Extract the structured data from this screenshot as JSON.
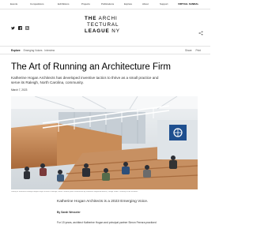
{
  "topnav": {
    "items": [
      "Events",
      "Competitions",
      "Exhibitions",
      "Projects",
      "Publications",
      "Explore",
      "About",
      "Support"
    ],
    "cta": "VIRTUAL SANDAL"
  },
  "logo": {
    "line1_bold": "THE",
    "line1_light": "ARCHI",
    "line2": "TECTURAL",
    "line3_bold": "LEAGUE",
    "line3_light": "NY"
  },
  "subnav": {
    "section": "Explore",
    "tags": [
      "Emerging Voices",
      "Interview"
    ],
    "actions": [
      "Share",
      "Print"
    ]
  },
  "article": {
    "title": "The Art of Running an Architecture Firm",
    "dek": "Katherine Hogan Architects has developed inventive tactics to thrive as a small practice and serve its Raleigh, North Carolina, community.",
    "date": "March 7, 2023",
    "caption": "Library at Southeast Raleigh Magnet High School in Raleigh, North Carolina (with construction by Katherine Hogan Architects). Image credit: Courtesy of the architect.",
    "byline_head": "Katherine Hogan Architects is a 2023 Emerging Voice.",
    "author": "By Sarah Wesseler",
    "body_start": "For 15 years, architect Katherine Hogan and principal partner Simon Ferrara practiced"
  },
  "colors": {
    "text": "#111111",
    "muted": "#555555",
    "rule": "#e3e3e3",
    "wood": "#c98f5c"
  },
  "icons": {
    "social": [
      "twitter-icon",
      "facebook-icon",
      "instagram-icon"
    ],
    "share": "share-icon"
  }
}
